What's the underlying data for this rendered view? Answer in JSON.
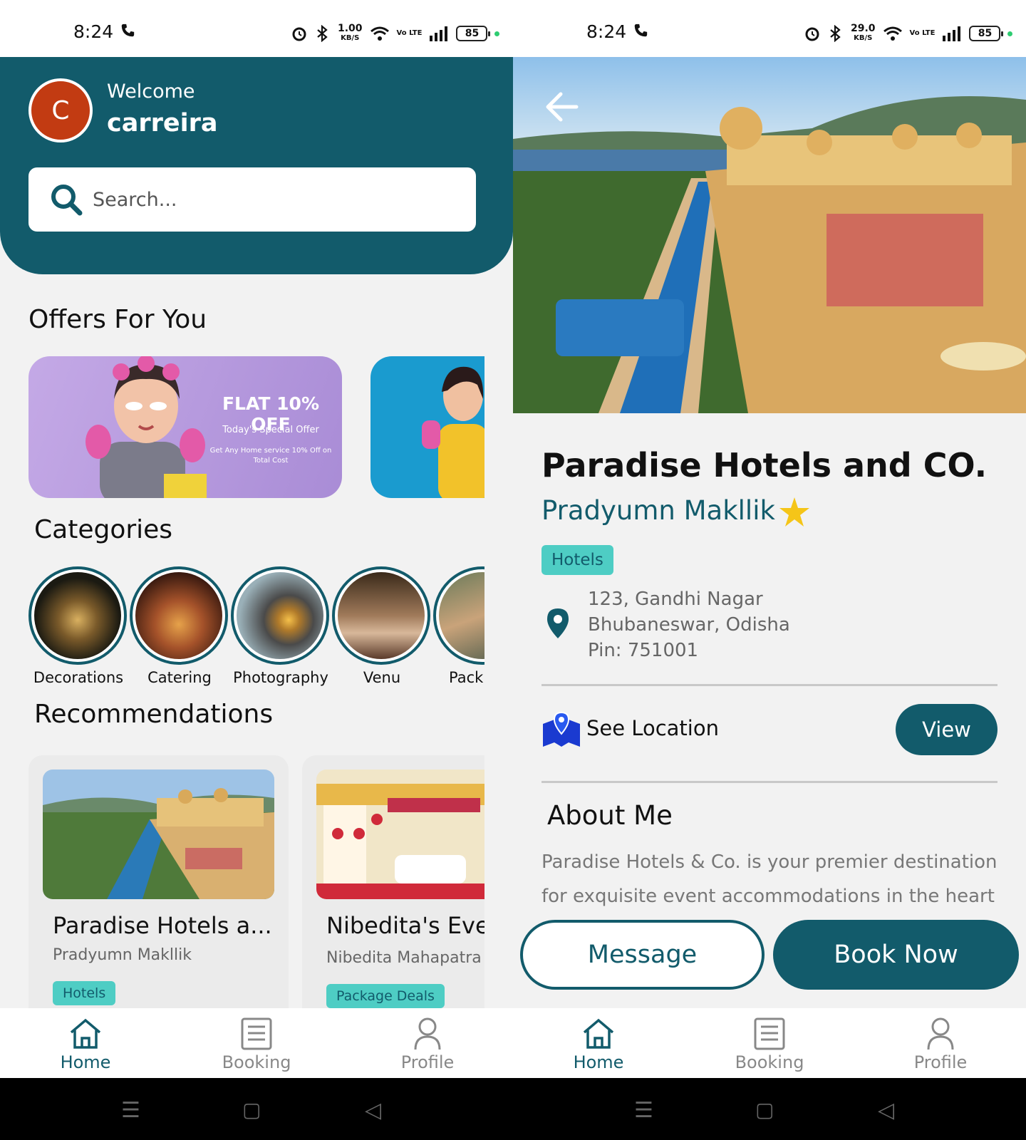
{
  "status_bar": {
    "time": "8:24",
    "battery": "85",
    "left_speed": "1.00",
    "right_speed": "29.0",
    "speed_unit": "KB/S",
    "volte": "Vo LTE"
  },
  "home": {
    "welcome": "Welcome",
    "username": "carreira",
    "avatar_initial": "C",
    "search_placeholder": "Search...",
    "offers_title": "Offers For You",
    "offer": {
      "headline": "FLAT 10% OFF",
      "subline": "Today's Special Offer",
      "fine_print": "Get Any Home service 10% Off on Total Cost"
    },
    "categories_title": "Categories",
    "categories": [
      "Decorations",
      "Catering",
      "Photography",
      "Venu",
      "Pack"
    ],
    "recommendations_title": "Recommendations",
    "recommendations": [
      {
        "title": "Paradise Hotels a...",
        "owner": "Pradyumn Makllik",
        "tag": "Hotels"
      },
      {
        "title": "Nibedita's Even",
        "owner": "Nibedita Mahapatra",
        "tag": "Package Deals"
      }
    ]
  },
  "detail": {
    "title": "Paradise Hotels and CO.",
    "owner": "Pradyumn Makllik",
    "tag": "Hotels",
    "address": [
      "123, Gandhi Nagar",
      "Bhubaneswar, Odisha",
      "Pin: 751001"
    ],
    "see_location": "See Location",
    "view_label": "View",
    "about_title": "About Me",
    "about_text": "Paradise Hotels & Co. is your premier destination for exquisite event accommodations in the heart of",
    "message_label": "Message",
    "book_label": "Book Now"
  },
  "nav": {
    "home": "Home",
    "booking": "Booking",
    "profile": "Profile"
  },
  "colors": {
    "primary": "#125b6b",
    "tag": "#4ecdc4",
    "avatar": "#c23b12"
  }
}
